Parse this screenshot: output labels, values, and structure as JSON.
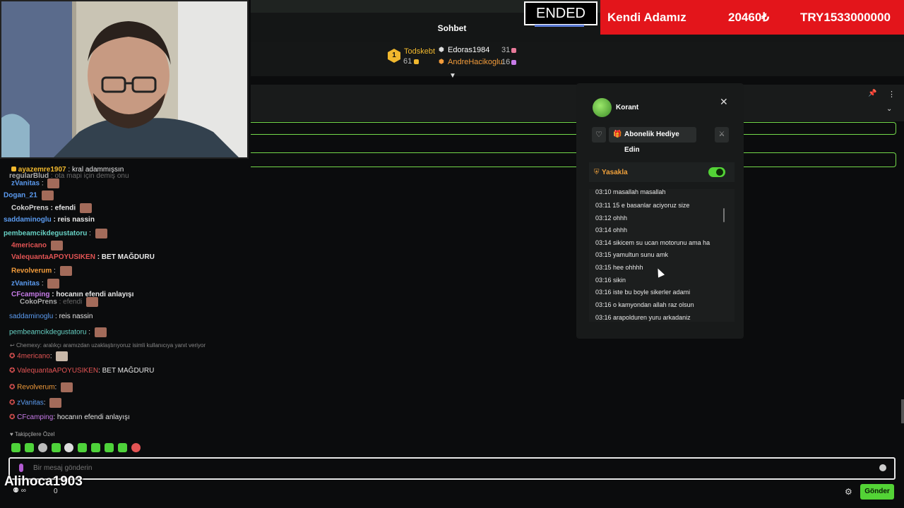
{
  "header": {
    "chat_title": "Sohbet",
    "status": "ENDED",
    "banner": {
      "name": "Kendi Adamız",
      "amount": "20460₺",
      "goal": "TRY1533000000"
    }
  },
  "leaderboard": {
    "rank": "1",
    "first": {
      "name": "Todskebt",
      "points": "61"
    },
    "second": {
      "name": "Edoras1984",
      "points": "31"
    },
    "third": {
      "name": "AndreHacikoglu",
      "points": "16"
    }
  },
  "chat": {
    "lines": [
      {
        "user": "ayazemre1907",
        "text": ": kral adammışsın",
        "color": "#f1b82e"
      },
      {
        "user": "regularBlud",
        "text": ": ota mapi için demiş onu",
        "color": "#bbbbbb"
      },
      {
        "user": "zVanitas",
        "text": " :",
        "color": "#5b9bf0"
      },
      {
        "user": "Dogan_21",
        "text": "",
        "color": "#5b9bf0"
      },
      {
        "user": "CokoPrens",
        "text": ": efendi",
        "color": "#d8d8d8"
      },
      {
        "user": "saddaminoglu",
        "text": ": reis nassin",
        "color": "#5b9bf0"
      },
      {
        "user": "pembeamcikdegustatoru",
        "text": " :",
        "color": "#67d1c4"
      },
      {
        "user": "4mericano",
        "text": "",
        "color": "#e35454"
      },
      {
        "user": "ValequantaAPOYUSIKEN",
        "text": ": BET MAĞDURU",
        "color": "#e35454"
      },
      {
        "user": "Revolverum",
        "text": " :",
        "color": "#f39c3b"
      },
      {
        "user": "zVanitas",
        "text": " :",
        "color": "#5b9bf0"
      },
      {
        "user": "CFcamping",
        "text": ": hocanın efendi anlayışı",
        "color": "#c77be8"
      },
      {
        "user": "CokoPrens",
        "text": ": efendi",
        "color": "#bbbbbb"
      },
      {
        "user": "saddaminoglu",
        "text": ": reis nassin",
        "color": "#5b9bf0"
      },
      {
        "user": "pembeamcikdegustatoru",
        "text": ":",
        "color": "#67d1c4"
      },
      {
        "user": "Chemexy",
        "text": ": aralıkçı aramızdan uzaklaştırıyoruz isimli kullanıcıya yanıt veriyor",
        "color": "#8a8a8a"
      },
      {
        "user": "4mericano",
        "text": ":",
        "color": "#e35454"
      },
      {
        "user": "ValequantaAPOYUSIKEN",
        "text": ": BET MAĞDURU",
        "color": "#e35454"
      },
      {
        "user": "Revolverum",
        "text": ":",
        "color": "#f39c3b"
      },
      {
        "user": "zVanitas",
        "text": ":",
        "color": "#5b9bf0"
      },
      {
        "user": "CFcamping",
        "text": ": hocanın efendi anlayışı",
        "color": "#c77be8"
      }
    ]
  },
  "user_card": {
    "name": "Korant",
    "gift_label": "Abonelik Hediye Edin",
    "ban_label": "Yasakla",
    "history": [
      "03:10 masallah masallah",
      "03:11 15 e basanlar aciyoruz size",
      "03:12 ohhh",
      "03:14 ohhh",
      "03:14 sikicem su ucan motorunu ama ha",
      "03:15 yamultun sunu amk",
      "03:15 hee ohhhh",
      "03:16 sikin",
      "03:16 iste bu boyle sikerler adami",
      "03:16 o kamyondan allah raz olsun",
      "03:16 arapolduren yuru arkadaniz"
    ]
  },
  "footer": {
    "follower_label": "Takipçilere Özel",
    "placeholder": "Bir mesaj gönderin",
    "overlay_user": "Alihoca1903",
    "count": "0",
    "send_label": "Gönder"
  },
  "colors": {
    "accent": "#53d336",
    "banner": "#e3151b"
  }
}
